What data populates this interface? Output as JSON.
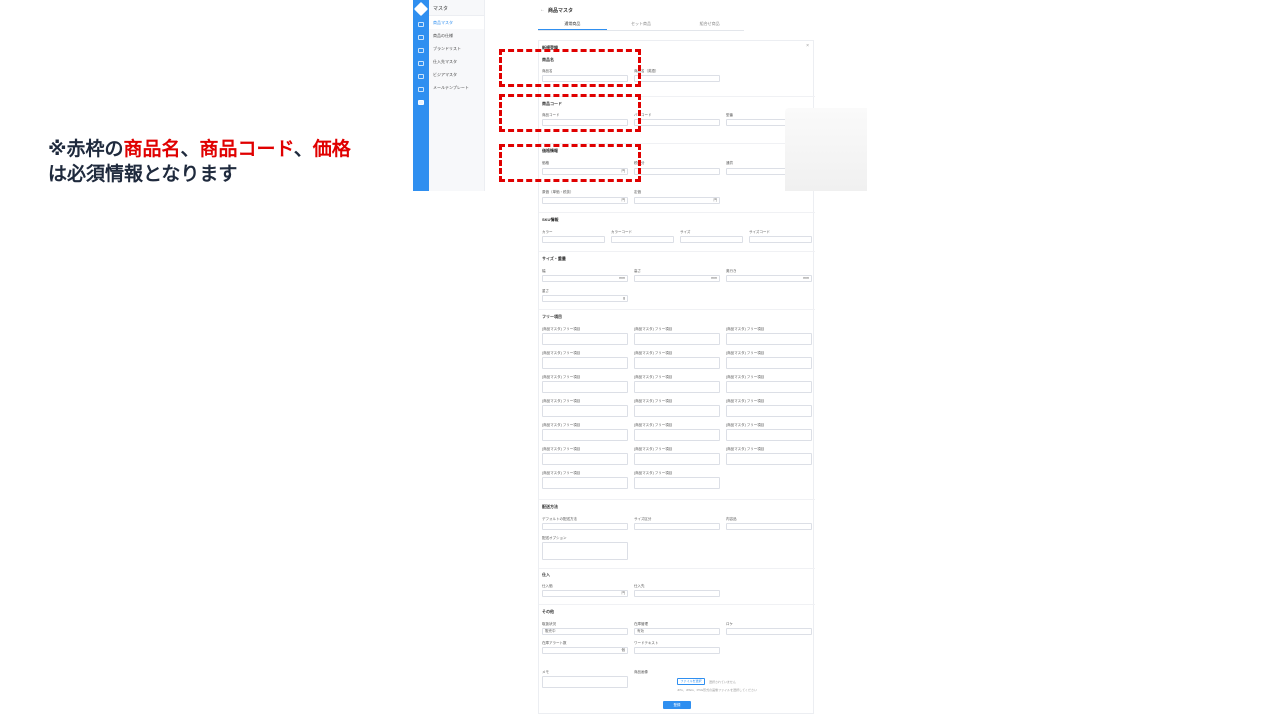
{
  "note": {
    "prefix": "※赤枠の",
    "field1": "商品名",
    "sep1": "、",
    "field2": "商品コード",
    "sep2": "、",
    "field3": "価格",
    "line2": "は必須情報となります"
  },
  "sidebar": {
    "title": "マスタ",
    "items": [
      {
        "label": "商品マスタ"
      },
      {
        "label": "商品の仕様"
      },
      {
        "label": "ブランドリスト"
      },
      {
        "label": "仕入先マスタ"
      },
      {
        "label": "ビジアマスタ"
      },
      {
        "label": "メールテンプレート"
      }
    ]
  },
  "header": {
    "back": "←",
    "title": "商品マスタ"
  },
  "tabs": [
    {
      "label": "通常商品"
    },
    {
      "label": "セット商品"
    },
    {
      "label": "組合せ商品"
    }
  ],
  "form": {
    "close": "×",
    "top_label": "新規登録",
    "sections": {
      "name": "商品名",
      "code": "商品コード",
      "price": "価格情報",
      "sku": "SKU情報",
      "size": "サイズ・重量",
      "free": "フリー項目",
      "shipping": "配送方法",
      "purchase": "仕入",
      "other": "その他"
    },
    "labels": {
      "name": "商品名",
      "name_en": "商品名（英語）",
      "code": "商品コード",
      "barcode": "バーコード",
      "model": "型番",
      "price": "価格",
      "tax": "税区分",
      "currency": "通貨",
      "cost": "原価（単価・税抜）",
      "retail": "定価",
      "color": "カラー",
      "color_code": "カラーコード",
      "size": "サイズ",
      "size_code": "サイズコード",
      "width": "幅",
      "height": "高さ",
      "depth": "奥行き",
      "weight": "重さ",
      "ship_default": "デフォルトの配送方法",
      "ship_size": "サイズ区分",
      "ship_content": "内容品",
      "ship_option": "配送オプション",
      "supplier_price": "仕入価",
      "supplier": "仕入先",
      "handling": "取扱状況",
      "stock_manage": "在庫管理",
      "location": "ロケ",
      "stock_alert": "在庫アラート数",
      "tag_text": "ワードテキスト",
      "memo": "メモ",
      "image": "商品画像"
    },
    "units": {
      "yen": "円",
      "mm": "mm",
      "g": "g",
      "pct": "%",
      "pieces": "個"
    },
    "select_values": {
      "handling": "販売中",
      "stock": "有効"
    },
    "free_item_label": "(商品マスタ) フリー項目",
    "file_button": "ファイルを選択",
    "file_status": "選択されていません",
    "file_hint": "JPG、JPEG、PNG形式の画像ファイルを選択してください",
    "register": "登録"
  }
}
